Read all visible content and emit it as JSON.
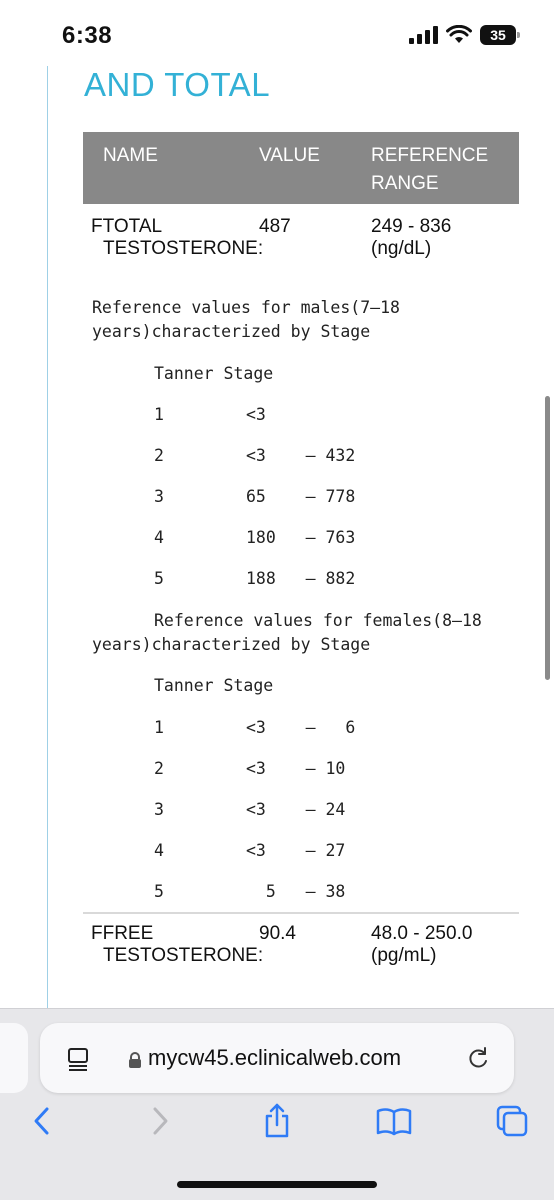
{
  "status": {
    "time": "6:38",
    "battery": "35"
  },
  "report": {
    "section_title": "AND TOTAL",
    "columns": {
      "name": "NAME",
      "value": "VALUE",
      "reference": "REFERENCE RANGE"
    },
    "total_testosterone": {
      "name_first": "FTOTAL",
      "name_rest": "TESTOSTERONE:",
      "value": "487",
      "range": "249 - 836 (ng/dL)"
    },
    "males_note_line1": "Reference values for males(7–18",
    "males_note_line2": "years)characterized by Stage",
    "males_heading": "Tanner Stage",
    "males_rows": [
      {
        "stage": "1",
        "range": "<3"
      },
      {
        "stage": "2",
        "range": "<3    – 432"
      },
      {
        "stage": "3",
        "range": "65    – 778"
      },
      {
        "stage": "4",
        "range": "180   – 763"
      },
      {
        "stage": "5",
        "range": "188   – 882"
      }
    ],
    "females_note_line1": "Reference values for females(8–18",
    "females_note_line2": "years)characterized by Stage",
    "females_heading": "Tanner Stage",
    "females_rows": [
      {
        "stage": "1",
        "range": "<3    –   6"
      },
      {
        "stage": "2",
        "range": "<3    – 10"
      },
      {
        "stage": "3",
        "range": "<3    – 24"
      },
      {
        "stage": "4",
        "range": "<3    – 27"
      },
      {
        "stage": "5",
        "range": "  5   – 38"
      }
    ],
    "free_testosterone": {
      "name_first": "FFREE",
      "name_rest": "TESTOSTERONE:",
      "value": "90.4",
      "range": "48.0 - 250.0 (pg/mL)"
    }
  },
  "browser": {
    "url": "mycw45.eclinicalweb.com",
    "accent_color": "#2f7bf6",
    "toolbar_icons": [
      "back-icon",
      "forward-icon",
      "share-icon",
      "bookmarks-icon",
      "tabs-icon"
    ]
  }
}
